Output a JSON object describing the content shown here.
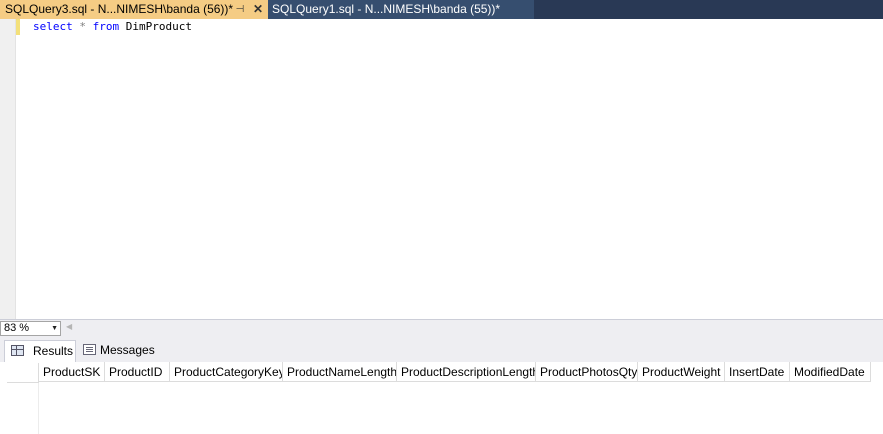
{
  "tabs": {
    "active_label": "SQLQuery3.sql - N...NIMESH\\banda (56))*",
    "inactive_label": "SQLQuery1.sql - N...NIMESH\\banda (55))*",
    "pin_glyph": "⊣",
    "close_glyph": "✕"
  },
  "editor": {
    "keyword_select": "select",
    "star": "*",
    "keyword_from": "from",
    "table_name": "DimProduct"
  },
  "zoom": {
    "value": "83 %"
  },
  "results_tabs": {
    "results_label": "Results",
    "messages_label": "Messages"
  },
  "grid": {
    "columns": [
      "ProductSK",
      "ProductID",
      "ProductCategoryKey",
      "ProductNameLength",
      "ProductDescriptionLength",
      "ProductPhotosQty",
      "ProductWeight",
      "InsertDate",
      "ModifiedDate"
    ]
  },
  "colors": {
    "tabstrip_bg": "#293955",
    "active_tab_bg": "#f5cc84",
    "inactive_tab_bg": "#364e6f",
    "keyword": "#0000ff",
    "operator": "#808080"
  }
}
